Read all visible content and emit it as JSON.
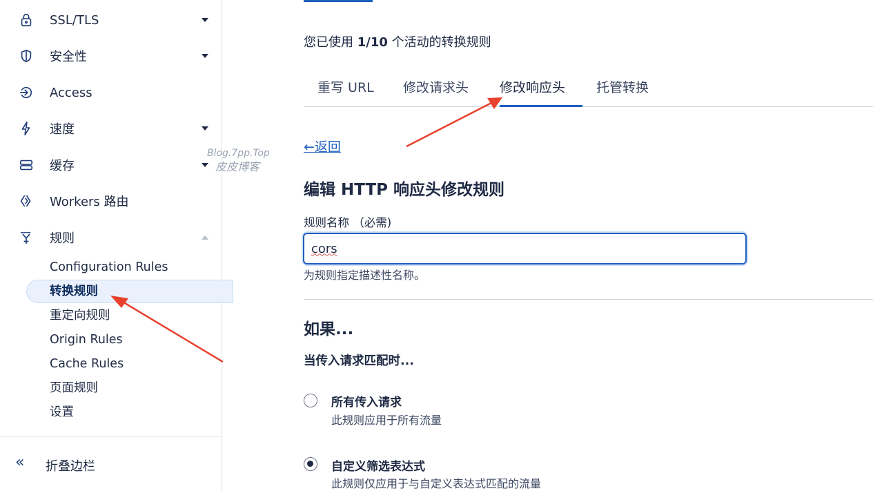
{
  "sidebar": {
    "items": [
      {
        "label": "SSL/TLS",
        "icon": "lock-icon",
        "caret": "down"
      },
      {
        "label": "安全性",
        "icon": "shield-icon",
        "caret": "down"
      },
      {
        "label": "Access",
        "icon": "access-icon",
        "caret": ""
      },
      {
        "label": "速度",
        "icon": "lightning-icon",
        "caret": "down"
      },
      {
        "label": "缓存",
        "icon": "storage-icon",
        "caret": "down"
      },
      {
        "label": "Workers 路由",
        "icon": "workers-icon",
        "caret": ""
      },
      {
        "label": "规则",
        "icon": "rules-icon",
        "caret": "up"
      }
    ],
    "sub_items": [
      {
        "label": "Configuration Rules"
      },
      {
        "label": "转换规则",
        "active": true
      },
      {
        "label": "重定向规则"
      },
      {
        "label": "Origin Rules"
      },
      {
        "label": "Cache Rules"
      },
      {
        "label": "页面规则"
      },
      {
        "label": "设置"
      }
    ],
    "collapse_label": "折叠边栏",
    "collapse_icon": "«"
  },
  "watermark": {
    "line1": "Blog.7pp.Top",
    "line2": "皮皮博客"
  },
  "main": {
    "usage_prefix": "您已使用 ",
    "usage_count": "1/10",
    "usage_suffix": " 个活动的转换规则",
    "tabs": [
      {
        "label": "重写 URL"
      },
      {
        "label": "修改请求头"
      },
      {
        "label": "修改响应头",
        "active": true
      },
      {
        "label": "托管转换"
      }
    ],
    "back_arrow": "←",
    "back_label": "返回",
    "title": "编辑 HTTP 响应头修改规则",
    "rule_name_label": "规则名称 （必需)",
    "rule_name_value": "cors",
    "rule_name_help": "为规则指定描述性名称。",
    "if_heading": "如果...",
    "match_heading": "当传入请求匹配时...",
    "options": [
      {
        "title": "所有传入请求",
        "desc": "此规则应用于所有流量",
        "checked": false
      },
      {
        "title": "自定义筛选表达式",
        "desc": "此规则仅应用于与自定义表达式匹配的流量",
        "checked": true
      }
    ]
  },
  "colors": {
    "accent": "#1f5fbf",
    "arrow": "#e8412e",
    "active_bg": "#eaf1fc"
  }
}
